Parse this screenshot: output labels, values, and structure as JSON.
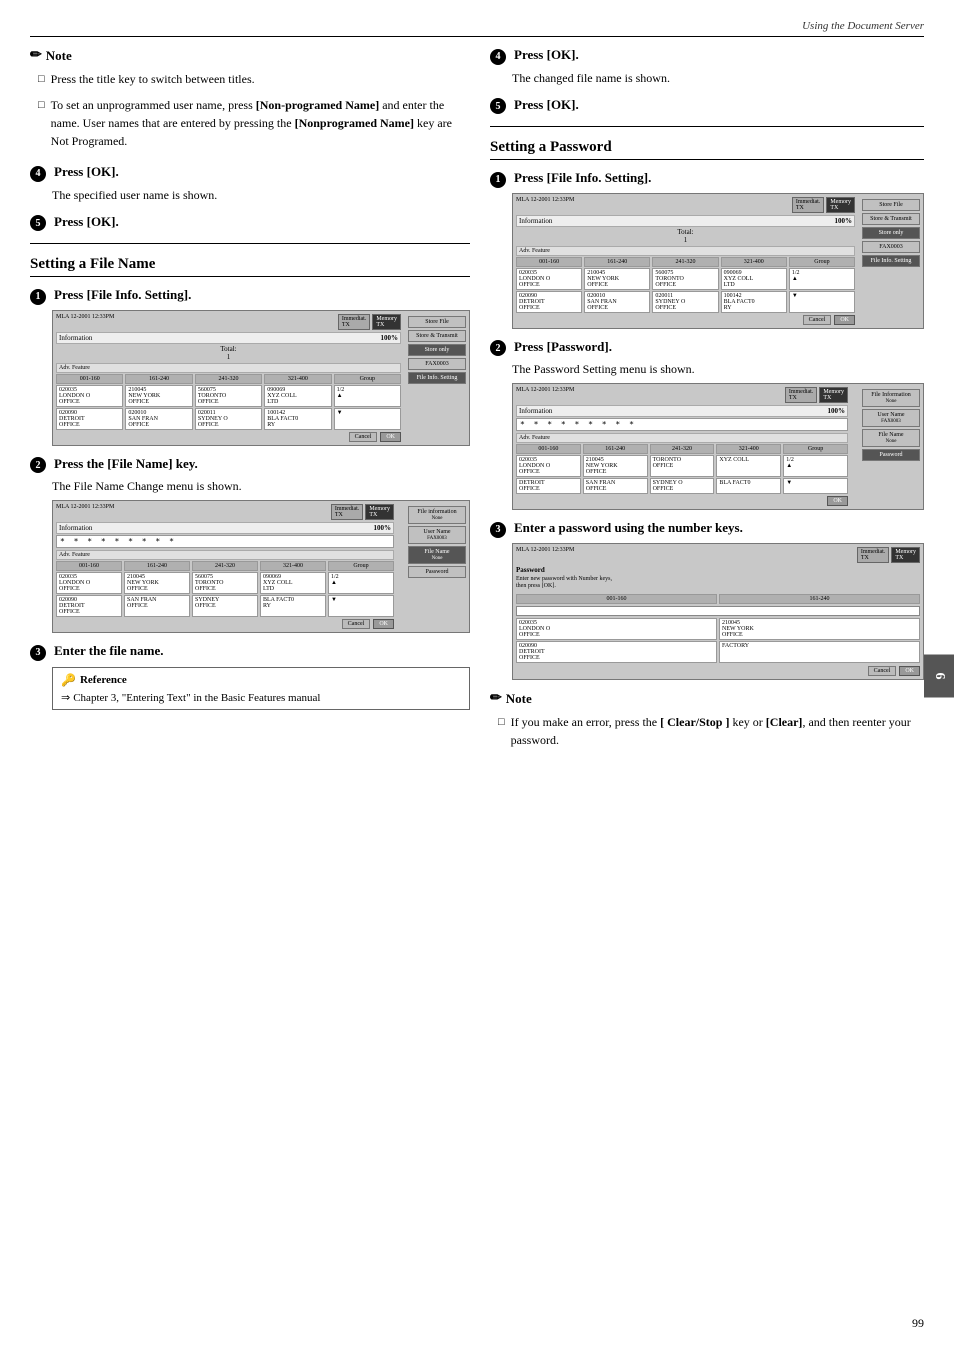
{
  "header": {
    "title": "Using the Document Server"
  },
  "page_number": "99",
  "tab_number": "6",
  "left_column": {
    "note_section": {
      "title": "Note",
      "items": [
        "Press the title key to switch between titles.",
        "To set an unprogrammed user name, press [Non-programed Name] and enter the name. User names that are entered by pressing the [Nonprogramed Name] key are Not Programed."
      ]
    },
    "step4_press_ok": {
      "label": "Press [OK].",
      "desc": "The specified user name is shown."
    },
    "step5_press_ok": {
      "label": "Press [OK]."
    },
    "section_heading": "Setting a File Name",
    "step1_file_info": {
      "label": "Press [File Info. Setting].",
      "screen_label": "File Info Setting screen 1"
    },
    "step2_file_name": {
      "label": "Press the [File Name] key.",
      "desc": "The File Name Change menu is shown."
    },
    "step3_enter_file": {
      "label": "Enter the file name.",
      "reference": {
        "title": "Reference",
        "arrow": "⇒",
        "text": "Chapter 3, \"Entering Text\" in the Basic Features manual"
      }
    },
    "step4_press_ok2": {
      "label": "Press [OK].",
      "desc": "The changed file name is shown."
    },
    "step5_press_ok2": {
      "label": "Press [OK]."
    }
  },
  "right_column": {
    "step4_right": {
      "label": "Press [OK].",
      "desc": "The changed file name is shown."
    },
    "step5_right": {
      "label": "Press [OK]."
    },
    "section_heading": "Setting a Password",
    "step1_file_info": {
      "label": "Press [File Info. Setting]."
    },
    "step2_password": {
      "label": "Press [Password].",
      "desc": "The Password Setting menu is shown."
    },
    "step3_enter_password": {
      "label": "Enter a password using the number keys."
    },
    "note": {
      "title": "Note",
      "items": [
        "If you make an error, press the [ Clear/Stop ] key or [Clear], and then reenter your password."
      ]
    }
  },
  "screens": {
    "file_info_screen": {
      "info_label": "Information",
      "tx_label": "Immediat. TX",
      "memory_label": "Memory TX",
      "percent": "100%",
      "total": "Total: 1",
      "adv_label": "Adv. Feature",
      "columns": [
        "001-160",
        "161-240",
        "241-320",
        "321-400",
        "Group"
      ],
      "rows": [
        [
          "020035\nLONDON O\nOFFICE",
          "210045\nNEW YORK\nOFFICE",
          "560075\nTORONTO\nOFFICE",
          "090069\nXYZ COLL\nLTD"
        ],
        [
          "020090\nDETROIT\nOFFICE",
          "020010\nSAN FRAN\nOFFICE",
          "020011\nSYDNEY O\nOFFICE",
          "100142\nBLA FACT0\nRY"
        ]
      ],
      "side_buttons": [
        "Store File",
        "Store & Transmit",
        "Store only",
        "FAX0003",
        "File Info. Setting"
      ],
      "bottom_buttons": [
        "Cancel",
        "OK"
      ]
    },
    "file_name_change_screen": {
      "asterisks": "* * * * * * * * *",
      "info_items": [
        {
          "label": "File information",
          "value": "None"
        },
        {
          "label": "User Name",
          "value": "FAX0003"
        },
        {
          "label": "File Name",
          "value": "None"
        },
        {
          "label": "",
          "value": "Password"
        }
      ],
      "bottom_buttons": [
        "Cancel",
        "OK"
      ]
    },
    "password_screen": {
      "title": "Password",
      "instruction": "Enter new password with Number keys,\nthen press [OK].",
      "bottom_buttons": [
        "Cancel",
        "OK"
      ]
    },
    "password_setting_screen": {
      "asterisks": "* * * * * * * * *",
      "info_items": [
        {
          "label": "File information",
          "value": "None"
        },
        {
          "label": "User Name",
          "value": "FAX0003"
        },
        {
          "label": "File Name",
          "value": "None"
        },
        {
          "label": "",
          "value": "Password"
        }
      ],
      "bottom_buttons": [
        "OK"
      ]
    }
  }
}
